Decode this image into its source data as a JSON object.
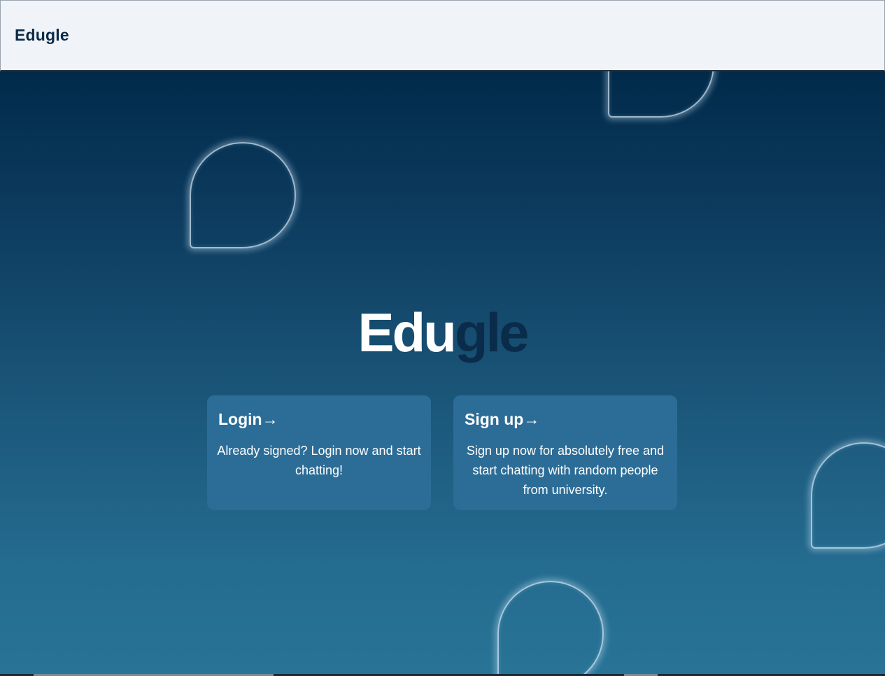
{
  "header": {
    "brand": "Edugle"
  },
  "hero": {
    "title_part1": "Edu",
    "title_part2": "gle",
    "color_primary": "#ffffff",
    "color_accent": "#0a2c4a"
  },
  "cards": {
    "login": {
      "title": "Login→",
      "body": "Already signed? Login now and start chatting!"
    },
    "signup": {
      "title": "Sign up→",
      "body": "Sign up now for absolutely free and start chatting with random people from university."
    }
  },
  "colors": {
    "header_bg": "#f0f4f9",
    "gradient_top": "#012a4a",
    "gradient_bottom": "#287496",
    "card_bg": "#2c6d97"
  },
  "decor": {
    "icon": "chat-bubble-outline-icon"
  }
}
